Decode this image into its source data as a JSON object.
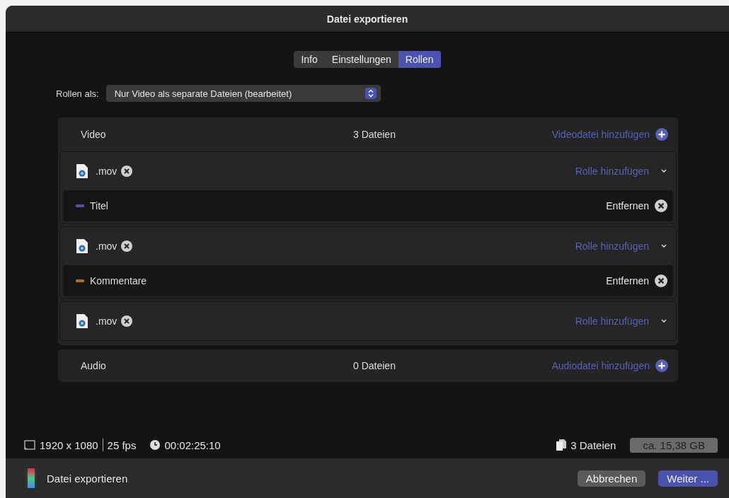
{
  "window": {
    "title": "Datei exportieren"
  },
  "tabs": [
    {
      "label": "Info",
      "selected": false
    },
    {
      "label": "Einstellungen",
      "selected": false
    },
    {
      "label": "Rollen",
      "selected": true
    }
  ],
  "roles_as": {
    "label": "Rollen als:",
    "value": "Nur Video als separate Dateien (bearbeitet)"
  },
  "video": {
    "label": "Video",
    "count": "3 Dateien",
    "add": "Videodatei hinzufügen",
    "files": [
      {
        "name": ".mov",
        "add_role": "Rolle hinzufügen",
        "roles": [
          {
            "name": "Titel",
            "color": "#5a4fb0",
            "remove": "Entfernen"
          }
        ]
      },
      {
        "name": ".mov",
        "add_role": "Rolle hinzufügen",
        "roles": [
          {
            "name": "Kommentare",
            "color": "#a8702c",
            "remove": "Entfernen"
          }
        ]
      },
      {
        "name": ".mov",
        "add_role": "Rolle hinzufügen"
      }
    ]
  },
  "audio": {
    "label": "Audio",
    "count": "0 Dateien",
    "add": "Audiodatei hinzufügen"
  },
  "info": {
    "resolution": "1920 x 1080",
    "fps": "25 fps",
    "duration": "00:02:25:10",
    "files": "3 Dateien",
    "size": "ca. 15,38 GB"
  },
  "footer": {
    "label": "Datei exportieren",
    "buttons": [
      {
        "label": "Abbrechen",
        "primary": false
      },
      {
        "label": "Weiter ...",
        "primary": true
      }
    ]
  }
}
